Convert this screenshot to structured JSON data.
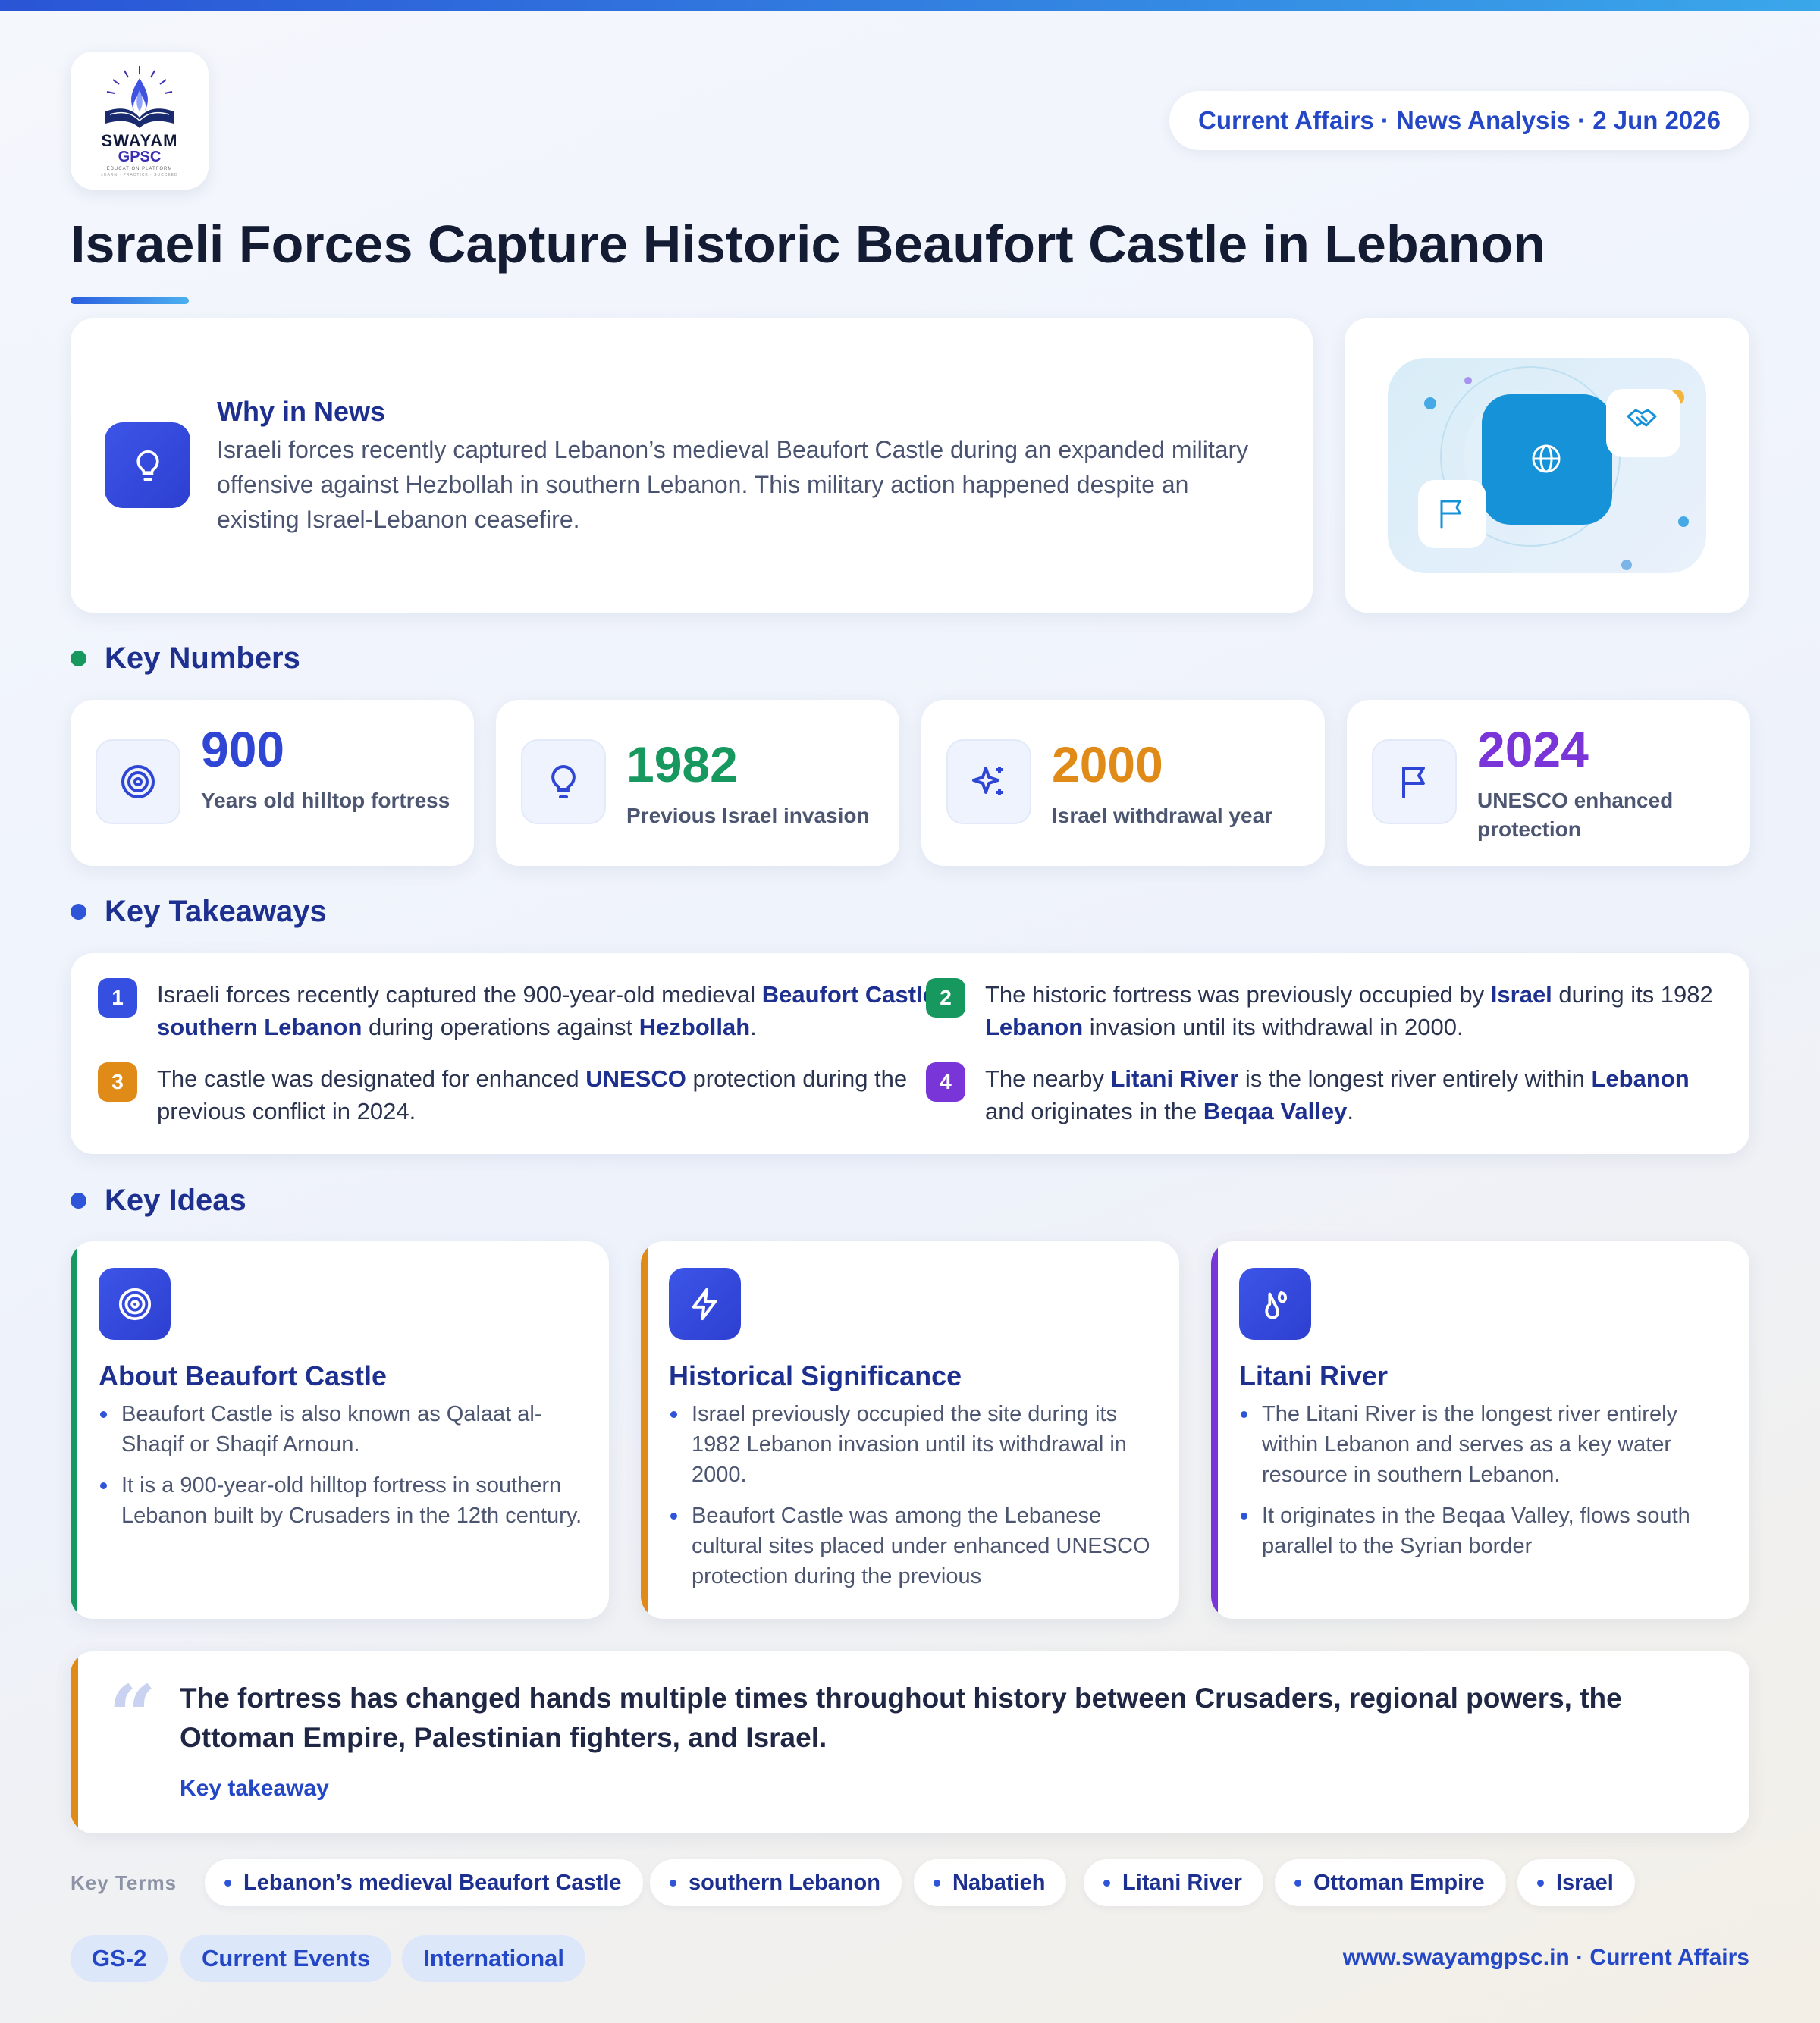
{
  "brand": {
    "name_line1": "SWAYAM",
    "name_line2": "GPSC",
    "tagline": "EDUCATION PLATFORM",
    "motto": "LEARN · PRACTICE · SUCCEED"
  },
  "header": {
    "date_pill": "Current Affairs · News Analysis · 2 Jun 2026",
    "title": "Israeli Forces Capture Historic Beaufort Castle in Lebanon"
  },
  "why_in_news": {
    "heading": "Why in News",
    "text": "Israeli forces recently captured Lebanon’s medieval Beaufort Castle during an expanded military offensive against Hezbollah in southern Lebanon. This military action happened despite an existing Israel-Lebanon ceasefire.",
    "icon": "lightbulb-icon"
  },
  "key_numbers": {
    "heading": "Key Numbers",
    "items": [
      {
        "value": "900",
        "label": "Years old hilltop fortress",
        "icon": "target-icon",
        "color": "#2f46d4"
      },
      {
        "value": "1982",
        "label": "Previous Israel invasion",
        "icon": "lightbulb-icon",
        "color": "#17985f"
      },
      {
        "value": "2000",
        "label": "Israel withdrawal year",
        "icon": "sparkles-icon",
        "color": "#e08a18"
      },
      {
        "value": "2024",
        "label": "UNESCO enhanced protection",
        "icon": "flag-icon",
        "color": "#7a35d8"
      }
    ]
  },
  "key_takeaways": {
    "heading": "Key Takeaways",
    "items": [
      {
        "n": "1",
        "color": "#3550e0",
        "parts": [
          {
            "t": "Israeli forces recently captured the 900-year-old medieval "
          },
          {
            "t": "Beaufort Castle",
            "b": true
          },
          {
            "t": " in "
          },
          {
            "t": "southern Lebanon",
            "b": true
          },
          {
            "t": " during operations against "
          },
          {
            "t": "Hezbollah",
            "b": true
          },
          {
            "t": "."
          }
        ]
      },
      {
        "n": "2",
        "color": "#17985f",
        "parts": [
          {
            "t": "The historic fortress was previously occupied by "
          },
          {
            "t": "Israel",
            "b": true
          },
          {
            "t": " during its 1982 "
          },
          {
            "t": "Lebanon",
            "b": true
          },
          {
            "t": " invasion until its withdrawal in 2000."
          }
        ]
      },
      {
        "n": "3",
        "color": "#e08a18",
        "parts": [
          {
            "t": "The castle was designated for enhanced "
          },
          {
            "t": "UNESCO",
            "b": true
          },
          {
            "t": " protection during the previous conflict in 2024."
          }
        ]
      },
      {
        "n": "4",
        "color": "#7a35d8",
        "parts": [
          {
            "t": "The nearby "
          },
          {
            "t": "Litani River",
            "b": true
          },
          {
            "t": " is the longest river entirely within "
          },
          {
            "t": "Lebanon",
            "b": true
          },
          {
            "t": " and originates in the "
          },
          {
            "t": "Beqaa Valley",
            "b": true
          },
          {
            "t": "."
          }
        ]
      }
    ]
  },
  "key_ideas": {
    "heading": "Key Ideas",
    "cards": [
      {
        "title": "About Beaufort Castle",
        "icon": "target-icon",
        "stripe": "#17985f",
        "bullets": [
          "Beaufort Castle is also known as Qalaat al-Shaqif or Shaqif Arnoun.",
          "It is a 900-year-old hilltop fortress in southern Lebanon built by Crusaders in the 12th century."
        ]
      },
      {
        "title": "Historical Significance",
        "icon": "lightning-icon",
        "stripe": "#e08a18",
        "bullets": [
          "Israel previously occupied the site during its 1982 Lebanon invasion until its withdrawal in 2000.",
          "Beaufort Castle was among the Lebanese cultural sites placed under enhanced UNESCO protection during the previous"
        ]
      },
      {
        "title": "Litani River",
        "icon": "droplets-icon",
        "stripe": "#7a35d8",
        "bullets": [
          "The Litani River is the longest river entirely within Lebanon and serves as a key water resource in southern Lebanon.",
          "It originates in the Beqaa Valley, flows south parallel to the Syrian border"
        ]
      }
    ]
  },
  "quote": {
    "mark": "“",
    "text": "The fortress has changed hands multiple times throughout history between Crusaders, regional powers, the Ottoman Empire, Palestinian fighters, and Israel.",
    "label": "Key takeaway"
  },
  "key_terms": {
    "label": "Key Terms",
    "items": [
      "Lebanon’s medieval Beaufort Castle",
      "southern Lebanon",
      "Nabatieh",
      "Litani River",
      "Ottoman Empire",
      "Israel"
    ]
  },
  "tags": [
    "GS-2",
    "Current Events",
    "International"
  ],
  "footer": {
    "site": "www.swayamgpsc.in · Current Affairs"
  },
  "colors": {
    "accent": "#2447c6",
    "heading": "#1d2f8f",
    "title": "#141c34"
  }
}
